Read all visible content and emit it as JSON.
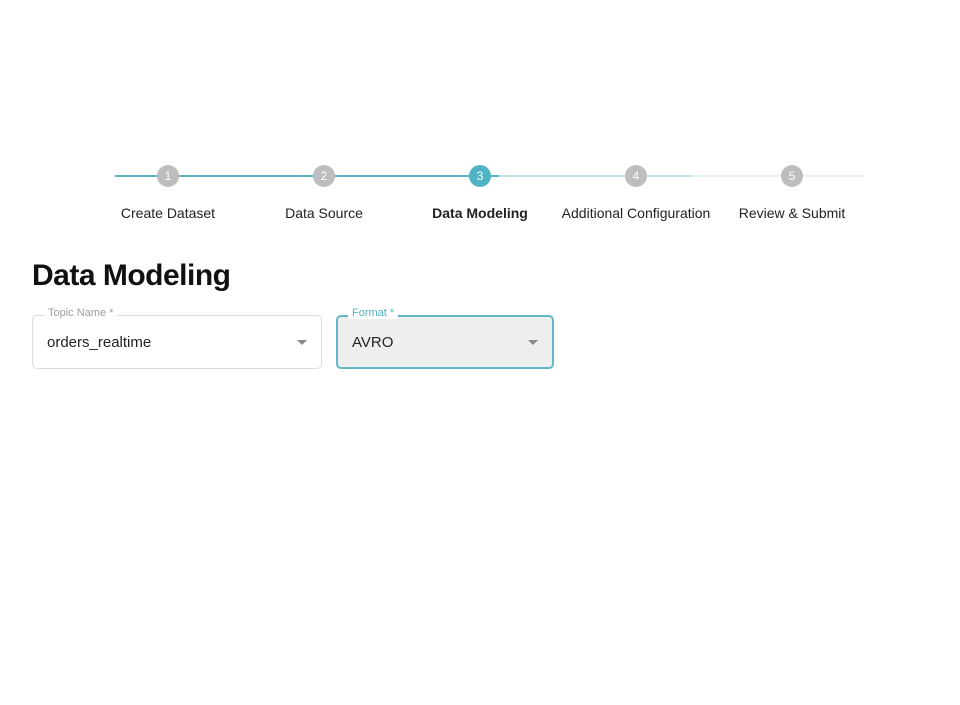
{
  "stepper": {
    "steps": [
      {
        "num": "1",
        "label": "Create Dataset",
        "active": false
      },
      {
        "num": "2",
        "label": "Data Source",
        "active": false
      },
      {
        "num": "3",
        "label": "Data Modeling",
        "active": true
      },
      {
        "num": "4",
        "label": "Additional Configuration",
        "active": false
      },
      {
        "num": "5",
        "label": "Review & Submit",
        "active": false
      }
    ]
  },
  "heading": "Data Modeling",
  "form": {
    "topic": {
      "label": "Topic Name *",
      "value": "orders_realtime"
    },
    "format": {
      "label": "Format *",
      "value": "AVRO"
    }
  },
  "colors": {
    "accent": "#4fb3c4",
    "connector_done": "#58b6c6",
    "connector_fade1": "#bfe2e8",
    "connector_fade2": "#e4f3f5"
  }
}
